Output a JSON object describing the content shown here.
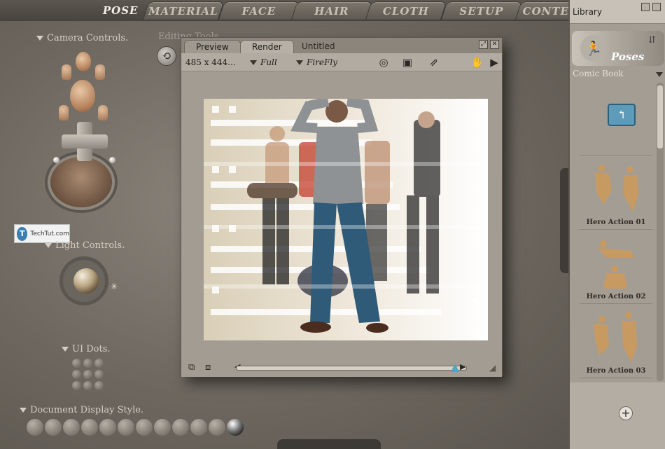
{
  "top_tabs": [
    "POSE",
    "MATERIAL",
    "FACE",
    "HAIR",
    "CLOTH",
    "SETUP",
    "CONTE"
  ],
  "active_tab": "POSE",
  "left_panel": {
    "camera_controls": "Camera Controls.",
    "light_controls": "Light Controls.",
    "ui_dots": "UI Dots.",
    "document_display_style": "Document Display Style.",
    "editing_tools": "Editing Tools",
    "watermark_text": "TechTut.com",
    "watermark_logo": "T"
  },
  "render_window": {
    "tabs": [
      "Preview",
      "Render",
      "Untitled"
    ],
    "active_tab": "Render",
    "size": "485 x 444...",
    "resolution": "Full",
    "renderer": "FireFly",
    "icons": [
      "camera-icon",
      "render-settings-icon",
      "export-icon",
      "hand-icon",
      "arrow-right-icon"
    ],
    "window_buttons": [
      "maximize-icon",
      "close-icon"
    ]
  },
  "library": {
    "title": "Library",
    "category": "Poses",
    "folder": "Comic Book",
    "items": [
      "Hero Action 01",
      "Hero Action 02",
      "Hero Action 03"
    ]
  },
  "colors": {
    "workspace": "#6e6860",
    "library_bg": "#a49d93",
    "accent": "#4fa5c2"
  }
}
